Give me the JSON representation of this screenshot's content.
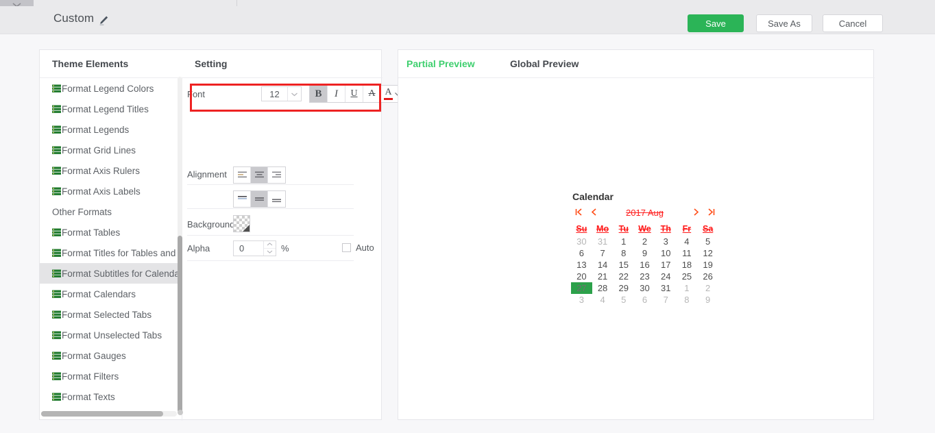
{
  "window": {
    "tab_chevron_icon": "chevron-down-icon"
  },
  "titlebar": {
    "title": "Custom",
    "edit_icon": "pencil-icon",
    "save_label": "Save",
    "save_as_label": "Save As",
    "cancel_label": "Cancel",
    "save_color": "#2bb457"
  },
  "panels": {
    "theme_elements_title": "Theme Elements",
    "setting_title": "Setting"
  },
  "theme_elements": {
    "items": [
      {
        "label": "Format Legend Colors",
        "icon": "list-icon",
        "selected": false,
        "has_icon": true
      },
      {
        "label": "Format Legend Titles",
        "icon": "list-icon",
        "selected": false,
        "has_icon": true
      },
      {
        "label": "Format Legends",
        "icon": "list-icon",
        "selected": false,
        "has_icon": true
      },
      {
        "label": "Format Grid Lines",
        "icon": "list-icon",
        "selected": false,
        "has_icon": true
      },
      {
        "label": "Format Axis Rulers",
        "icon": "list-icon",
        "selected": false,
        "has_icon": true
      },
      {
        "label": "Format Axis Labels",
        "icon": "list-icon",
        "selected": false,
        "has_icon": true
      },
      {
        "label": "Other Formats",
        "icon": "",
        "selected": false,
        "has_icon": false
      },
      {
        "label": "Format Tables",
        "icon": "list-icon",
        "selected": false,
        "has_icon": true
      },
      {
        "label": "Format Titles for Tables and Filt",
        "icon": "list-icon",
        "selected": false,
        "has_icon": true
      },
      {
        "label": "Format Subtitles for Calendars",
        "icon": "list-icon",
        "selected": true,
        "has_icon": true
      },
      {
        "label": "Format Calendars",
        "icon": "list-icon",
        "selected": false,
        "has_icon": true
      },
      {
        "label": "Format Selected Tabs",
        "icon": "list-icon",
        "selected": false,
        "has_icon": true
      },
      {
        "label": "Format Unselected Tabs",
        "icon": "list-icon",
        "selected": false,
        "has_icon": true
      },
      {
        "label": "Format Gauges",
        "icon": "list-icon",
        "selected": false,
        "has_icon": true
      },
      {
        "label": "Format Filters",
        "icon": "list-icon",
        "selected": false,
        "has_icon": true
      },
      {
        "label": "Format Texts",
        "icon": "list-icon",
        "selected": false,
        "has_icon": true
      }
    ]
  },
  "setting": {
    "font": {
      "label": "Font",
      "size_value": "12",
      "dropdown_icon": "chevron-down-icon",
      "bold_label": "B",
      "bold_active": true,
      "italic_label": "I",
      "italic_active": false,
      "underline_label": "U",
      "underline_active": false,
      "strikethrough_label": "A",
      "strikethrough_active": false,
      "color_label": "A",
      "color_value": "#e01b1b",
      "color_caret_icon": "caret-down-icon",
      "highlight_color": "#ee2222"
    },
    "alignment": {
      "label": "Alignment",
      "horizontal_options": [
        "align-left-icon",
        "align-center-icon",
        "align-right-icon"
      ],
      "horizontal_selected": 1,
      "vertical_options": [
        "align-top-icon",
        "align-middle-icon",
        "align-bottom-icon"
      ],
      "vertical_selected": 1
    },
    "background": {
      "label": "Background",
      "swatch": "transparent-checker-swatch"
    },
    "alpha": {
      "label": "Alpha",
      "value": "0",
      "unit": "%",
      "auto_label": "Auto",
      "auto_checked": false
    }
  },
  "preview": {
    "tabs": [
      {
        "label": "Partial Preview",
        "active": true
      },
      {
        "label": "Global Preview",
        "active": false
      }
    ],
    "calendar": {
      "title": "Calendar",
      "nav": {
        "first_icon": "first-page-icon",
        "prev_icon": "prev-icon",
        "next_icon": "next-icon",
        "last_icon": "last-page-icon",
        "first_glyph": "K",
        "prev_glyph": "‹",
        "next_glyph": "›",
        "last_glyph": "›|"
      },
      "month_label": "2017 Aug",
      "month_color": "#ff2020",
      "weekday_color": "#ff1a1a",
      "weekdays": [
        "Su",
        "Mo",
        "Tu",
        "We",
        "Th",
        "Fr",
        "Sa"
      ],
      "selected_day": "27",
      "selected_bg": "#2ca14a",
      "weeks": [
        [
          {
            "d": "30",
            "muted": true,
            "sel": false
          },
          {
            "d": "31",
            "muted": true,
            "sel": false
          },
          {
            "d": "1",
            "muted": false,
            "sel": false
          },
          {
            "d": "2",
            "muted": false,
            "sel": false
          },
          {
            "d": "3",
            "muted": false,
            "sel": false
          },
          {
            "d": "4",
            "muted": false,
            "sel": false
          },
          {
            "d": "5",
            "muted": false,
            "sel": false
          }
        ],
        [
          {
            "d": "6",
            "muted": false,
            "sel": false
          },
          {
            "d": "7",
            "muted": false,
            "sel": false
          },
          {
            "d": "8",
            "muted": false,
            "sel": false
          },
          {
            "d": "9",
            "muted": false,
            "sel": false
          },
          {
            "d": "10",
            "muted": false,
            "sel": false
          },
          {
            "d": "11",
            "muted": false,
            "sel": false
          },
          {
            "d": "12",
            "muted": false,
            "sel": false
          }
        ],
        [
          {
            "d": "13",
            "muted": false,
            "sel": false
          },
          {
            "d": "14",
            "muted": false,
            "sel": false
          },
          {
            "d": "15",
            "muted": false,
            "sel": false
          },
          {
            "d": "16",
            "muted": false,
            "sel": false
          },
          {
            "d": "17",
            "muted": false,
            "sel": false
          },
          {
            "d": "18",
            "muted": false,
            "sel": false
          },
          {
            "d": "19",
            "muted": false,
            "sel": false
          }
        ],
        [
          {
            "d": "20",
            "muted": false,
            "sel": false
          },
          {
            "d": "21",
            "muted": false,
            "sel": false
          },
          {
            "d": "22",
            "muted": false,
            "sel": false
          },
          {
            "d": "23",
            "muted": false,
            "sel": false
          },
          {
            "d": "24",
            "muted": false,
            "sel": false
          },
          {
            "d": "25",
            "muted": false,
            "sel": false
          },
          {
            "d": "26",
            "muted": false,
            "sel": false
          }
        ],
        [
          {
            "d": "27",
            "muted": false,
            "sel": true
          },
          {
            "d": "28",
            "muted": false,
            "sel": false
          },
          {
            "d": "29",
            "muted": false,
            "sel": false
          },
          {
            "d": "30",
            "muted": false,
            "sel": false
          },
          {
            "d": "31",
            "muted": false,
            "sel": false
          },
          {
            "d": "1",
            "muted": true,
            "sel": false
          },
          {
            "d": "2",
            "muted": true,
            "sel": false
          }
        ],
        [
          {
            "d": "3",
            "muted": true,
            "sel": false
          },
          {
            "d": "4",
            "muted": true,
            "sel": false
          },
          {
            "d": "5",
            "muted": true,
            "sel": false
          },
          {
            "d": "6",
            "muted": true,
            "sel": false
          },
          {
            "d": "7",
            "muted": true,
            "sel": false
          },
          {
            "d": "8",
            "muted": true,
            "sel": false
          },
          {
            "d": "9",
            "muted": true,
            "sel": false
          }
        ]
      ]
    }
  }
}
